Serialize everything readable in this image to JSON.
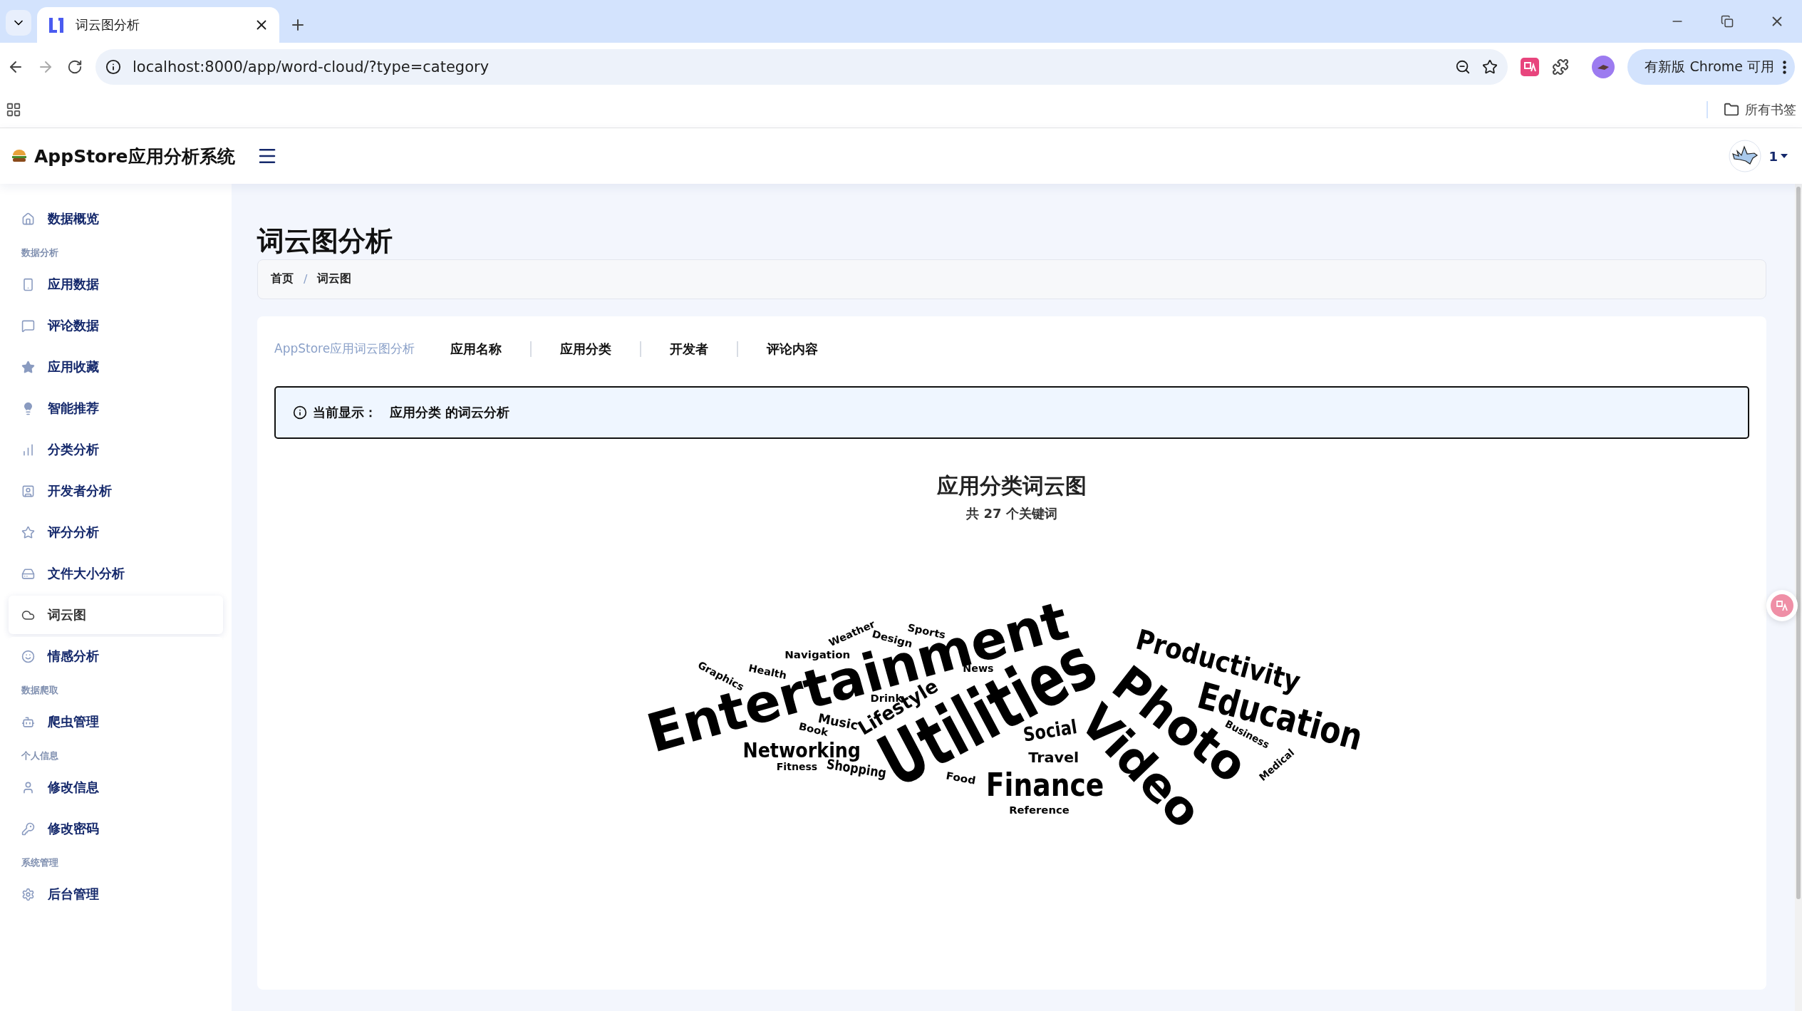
{
  "browser": {
    "tabs": [
      {
        "title": "词云图分析",
        "selected": true
      }
    ],
    "url": "localhost:8000/app/word-cloud/?type=category",
    "update_button": "有新版 Chrome 可用",
    "bookmarks_folder": "所有书签"
  },
  "header": {
    "brand": "AppStore应用分析系统",
    "user": "1"
  },
  "sidebar": {
    "sections": [
      {
        "items": [
          {
            "label": "数据概览",
            "selected": false
          }
        ]
      },
      {
        "heading": "数据分析",
        "items": [
          {
            "label": "应用数据",
            "selected": false
          },
          {
            "label": "评论数据",
            "selected": false
          },
          {
            "label": "应用收藏",
            "selected": false
          },
          {
            "label": "智能推荐",
            "selected": false
          },
          {
            "label": "分类分析",
            "selected": false
          },
          {
            "label": "开发者分析",
            "selected": false
          },
          {
            "label": "评分分析",
            "selected": false
          },
          {
            "label": "文件大小分析",
            "selected": false
          },
          {
            "label": "词云图",
            "selected": true
          },
          {
            "label": "情感分析",
            "selected": false
          }
        ]
      },
      {
        "heading": "数据爬取",
        "items": [
          {
            "label": "爬虫管理",
            "selected": false
          }
        ]
      },
      {
        "heading": "个人信息",
        "items": [
          {
            "label": "修改信息",
            "selected": false
          },
          {
            "label": "修改密码",
            "selected": false
          }
        ]
      },
      {
        "heading": "系统管理",
        "items": [
          {
            "label": "后台管理",
            "selected": false
          }
        ]
      }
    ]
  },
  "page": {
    "title": "词云图分析",
    "breadcrumb": [
      "首页",
      "词云图"
    ],
    "breadcrumb_separator": "/",
    "nav_title": "AppStore应用词云图分析",
    "nav_links": [
      "应用名称",
      "应用分类",
      "开发者",
      "评论内容"
    ],
    "alert": {
      "label": "当前显示：",
      "message": "应用分类 的词云分析"
    },
    "chart_title": "应用分类词云图",
    "chart_subtitle": "共 27 个关键词",
    "words": [
      "Entertainment",
      "Utilities",
      "Photo",
      "Video",
      "Productivity",
      "Education",
      "Finance",
      "Networking",
      "Lifestyle",
      "Social",
      "Travel",
      "Shopping",
      "Fitness",
      "Music",
      "Book",
      "Drink",
      "News",
      "Navigation",
      "Health",
      "Graphics",
      "Weather",
      "Design",
      "Sports",
      "Food",
      "Reference",
      "Business",
      "Medical"
    ]
  }
}
